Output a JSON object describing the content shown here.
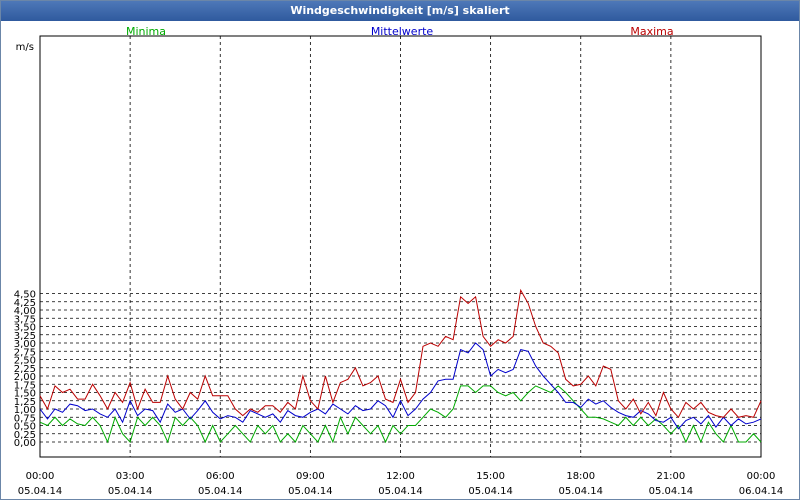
{
  "window": {
    "title": "Windgeschwindigkeit [m/s] skaliert"
  },
  "chart_data": {
    "type": "line",
    "title": "Windgeschwindigkeit [m/s] skaliert",
    "ylabel": "m/s",
    "xlabel": "",
    "ylim": [
      0,
      4.75
    ],
    "grid": true,
    "legend_placement": "top",
    "yticks": [
      "0,00",
      "0,25",
      "0,50",
      "0,75",
      "1,00",
      "1,25",
      "1,50",
      "1,75",
      "2,00",
      "2,25",
      "2,50",
      "2,75",
      "3,00",
      "3,25",
      "3,50",
      "3,75",
      "4,00",
      "4,25",
      "4,50"
    ],
    "xticks": [
      {
        "time": "00:00",
        "date": "05.04.14"
      },
      {
        "time": "03:00",
        "date": "05.04.14"
      },
      {
        "time": "06:00",
        "date": "05.04.14"
      },
      {
        "time": "09:00",
        "date": "05.04.14"
      },
      {
        "time": "12:00",
        "date": "05.04.14"
      },
      {
        "time": "15:00",
        "date": "05.04.14"
      },
      {
        "time": "18:00",
        "date": "05.04.14"
      },
      {
        "time": "21:00",
        "date": "05.04.14"
      },
      {
        "time": "00:00",
        "date": "06.04.14"
      }
    ],
    "series": [
      {
        "name": "Minima",
        "color": "#00aa00",
        "x": [
          0.0,
          0.25,
          0.5,
          0.75,
          1.0,
          1.25,
          1.5,
          1.75,
          2.0,
          2.25,
          2.5,
          2.75,
          3.0,
          3.25,
          3.5,
          3.75,
          4.0,
          4.25,
          4.5,
          4.75,
          5.0,
          5.25,
          5.5,
          5.75,
          6.0,
          6.25,
          6.5,
          6.75,
          7.0,
          7.25,
          7.5,
          7.75,
          8.0,
          8.25,
          8.5,
          8.75,
          9.0,
          9.25,
          9.5,
          9.75,
          10.0,
          10.25,
          10.5,
          10.75,
          11.0,
          11.25,
          11.5,
          11.75,
          12.0,
          12.25,
          12.5,
          12.75,
          13.0,
          13.25,
          13.5,
          13.75,
          14.0,
          14.25,
          14.5,
          14.75,
          15.0,
          15.25,
          15.5,
          15.75,
          16.0,
          16.25,
          16.5,
          16.75,
          17.0,
          17.25,
          17.5,
          17.75,
          18.0,
          18.25,
          18.5,
          18.75,
          19.0,
          19.25,
          19.5,
          19.75,
          20.0,
          20.25,
          20.5,
          20.75,
          21.0,
          21.25,
          21.5,
          21.75,
          22.0,
          22.25,
          22.5,
          22.75,
          23.0,
          23.25,
          23.5,
          23.75,
          24.0
        ],
        "values": [
          0.6,
          0.5,
          0.75,
          0.5,
          0.7,
          0.55,
          0.5,
          0.75,
          0.5,
          0.0,
          0.75,
          0.25,
          0.0,
          0.75,
          0.5,
          0.75,
          0.5,
          0.0,
          0.75,
          0.5,
          0.75,
          0.5,
          0.0,
          0.5,
          0.0,
          0.25,
          0.5,
          0.25,
          0.0,
          0.5,
          0.25,
          0.5,
          0.0,
          0.25,
          0.0,
          0.5,
          0.25,
          0.0,
          0.5,
          0.0,
          0.75,
          0.25,
          0.75,
          0.5,
          0.25,
          0.5,
          0.0,
          0.5,
          0.25,
          0.5,
          0.5,
          0.75,
          1.0,
          0.9,
          0.75,
          1.0,
          1.7,
          1.7,
          1.5,
          1.7,
          1.7,
          1.5,
          1.4,
          1.5,
          1.25,
          1.5,
          1.7,
          1.6,
          1.5,
          1.7,
          1.5,
          1.25,
          1.0,
          0.75,
          0.75,
          0.7,
          0.6,
          0.5,
          0.75,
          0.5,
          0.75,
          0.5,
          0.7,
          0.5,
          0.25,
          0.5,
          0.0,
          0.5,
          0.0,
          0.6,
          0.25,
          0.0,
          0.5,
          0.0,
          0.0,
          0.25,
          0.0
        ]
      },
      {
        "name": "Mittelwerte",
        "color": "#0000cc",
        "x": [
          0.0,
          0.25,
          0.5,
          0.75,
          1.0,
          1.25,
          1.5,
          1.75,
          2.0,
          2.25,
          2.5,
          2.75,
          3.0,
          3.25,
          3.5,
          3.75,
          4.0,
          4.25,
          4.5,
          4.75,
          5.0,
          5.25,
          5.5,
          5.75,
          6.0,
          6.25,
          6.5,
          6.75,
          7.0,
          7.25,
          7.5,
          7.75,
          8.0,
          8.25,
          8.5,
          8.75,
          9.0,
          9.25,
          9.5,
          9.75,
          10.0,
          10.25,
          10.5,
          10.75,
          11.0,
          11.25,
          11.5,
          11.75,
          12.0,
          12.25,
          12.5,
          12.75,
          13.0,
          13.25,
          13.5,
          13.75,
          14.0,
          14.25,
          14.5,
          14.75,
          15.0,
          15.25,
          15.5,
          15.75,
          16.0,
          16.25,
          16.5,
          16.75,
          17.0,
          17.25,
          17.5,
          17.75,
          18.0,
          18.25,
          18.5,
          18.75,
          19.0,
          19.25,
          19.5,
          19.75,
          20.0,
          20.25,
          20.5,
          20.75,
          21.0,
          21.25,
          21.5,
          21.75,
          22.0,
          22.25,
          22.5,
          22.75,
          23.0,
          23.25,
          23.5,
          23.75,
          24.0
        ],
        "values": [
          1.0,
          0.7,
          1.0,
          0.9,
          1.15,
          1.1,
          0.95,
          1.0,
          0.85,
          0.75,
          1.0,
          0.6,
          1.25,
          0.8,
          1.0,
          0.95,
          0.6,
          1.15,
          0.9,
          1.0,
          0.7,
          0.95,
          1.25,
          0.9,
          0.7,
          0.8,
          0.75,
          0.6,
          0.95,
          0.85,
          0.75,
          0.85,
          0.6,
          0.95,
          0.8,
          0.75,
          0.9,
          1.0,
          0.85,
          1.15,
          1.0,
          0.85,
          1.1,
          0.95,
          1.0,
          1.25,
          1.1,
          0.75,
          1.25,
          0.8,
          1.0,
          1.3,
          1.5,
          1.85,
          1.9,
          1.9,
          2.8,
          2.7,
          3.0,
          2.8,
          2.0,
          2.2,
          2.1,
          2.2,
          2.8,
          2.75,
          2.3,
          2.0,
          1.75,
          1.5,
          1.2,
          1.2,
          1.05,
          1.3,
          1.15,
          1.25,
          1.05,
          0.9,
          0.8,
          0.75,
          0.95,
          0.85,
          0.65,
          0.6,
          0.75,
          0.4,
          0.65,
          0.75,
          0.55,
          0.8,
          0.45,
          0.75,
          0.5,
          0.7,
          0.55,
          0.6,
          0.7
        ]
      },
      {
        "name": "Maxima",
        "color": "#bb0000",
        "x": [
          0.0,
          0.25,
          0.5,
          0.75,
          1.0,
          1.25,
          1.5,
          1.75,
          2.0,
          2.25,
          2.5,
          2.75,
          3.0,
          3.25,
          3.5,
          3.75,
          4.0,
          4.25,
          4.5,
          4.75,
          5.0,
          5.25,
          5.5,
          5.75,
          6.0,
          6.25,
          6.5,
          6.75,
          7.0,
          7.25,
          7.5,
          7.75,
          8.0,
          8.25,
          8.5,
          8.75,
          9.0,
          9.25,
          9.5,
          9.75,
          10.0,
          10.25,
          10.5,
          10.75,
          11.0,
          11.25,
          11.5,
          11.75,
          12.0,
          12.25,
          12.5,
          12.75,
          13.0,
          13.25,
          13.5,
          13.75,
          14.0,
          14.25,
          14.5,
          14.75,
          15.0,
          15.25,
          15.5,
          15.75,
          16.0,
          16.25,
          16.5,
          16.75,
          17.0,
          17.25,
          17.5,
          17.75,
          18.0,
          18.25,
          18.5,
          18.75,
          19.0,
          19.25,
          19.5,
          19.75,
          20.0,
          20.25,
          20.5,
          20.75,
          21.0,
          21.25,
          21.5,
          21.75,
          22.0,
          22.25,
          22.5,
          22.75,
          23.0,
          23.25,
          23.5,
          23.75,
          24.0
        ],
        "values": [
          1.4,
          1.0,
          1.7,
          1.5,
          1.6,
          1.3,
          1.3,
          1.75,
          1.4,
          1.0,
          1.5,
          1.2,
          1.8,
          1.0,
          1.6,
          1.2,
          1.2,
          2.0,
          1.3,
          1.0,
          1.5,
          1.3,
          2.0,
          1.4,
          1.4,
          1.4,
          1.0,
          0.8,
          1.0,
          0.9,
          1.1,
          1.1,
          0.9,
          1.2,
          1.0,
          2.0,
          1.25,
          1.0,
          2.0,
          1.2,
          1.8,
          1.9,
          2.25,
          1.7,
          1.8,
          2.0,
          1.3,
          1.2,
          1.9,
          1.2,
          1.5,
          2.9,
          3.0,
          2.9,
          3.2,
          3.1,
          4.4,
          4.2,
          4.4,
          3.2,
          2.9,
          3.1,
          3.0,
          3.2,
          4.6,
          4.2,
          3.5,
          3.0,
          2.9,
          2.7,
          1.9,
          1.7,
          1.75,
          2.0,
          1.7,
          2.3,
          2.2,
          1.25,
          1.0,
          1.3,
          0.85,
          1.2,
          0.8,
          1.5,
          1.0,
          0.75,
          1.2,
          1.0,
          1.2,
          0.9,
          0.8,
          0.75,
          1.0,
          0.75,
          0.8,
          0.75,
          1.25
        ]
      }
    ]
  }
}
